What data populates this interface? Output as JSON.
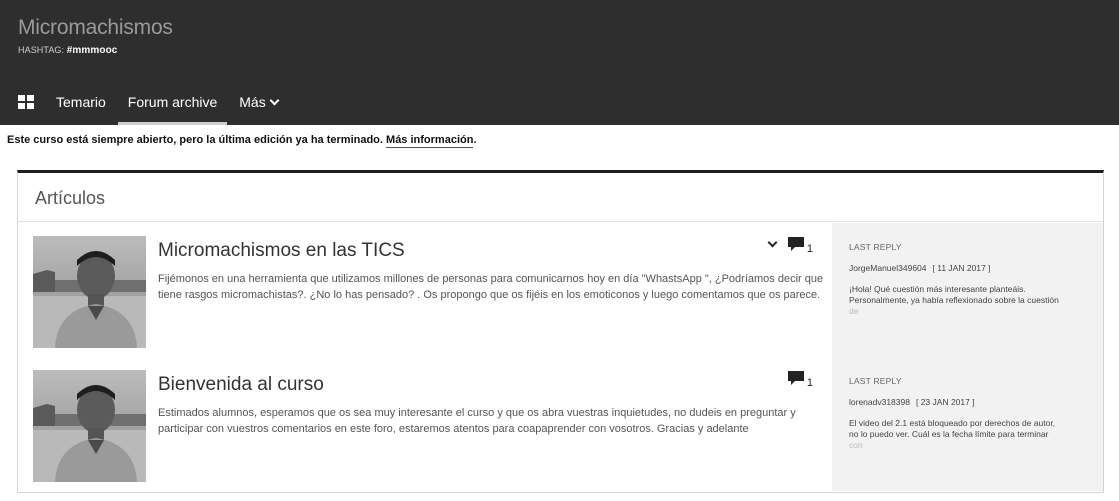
{
  "course": {
    "title": "Micromachismos",
    "hashtag_label": "HASHTAG:",
    "hashtag": "#mmmooc"
  },
  "nav": {
    "items": [
      {
        "label": "Temario",
        "active": false
      },
      {
        "label": "Forum archive",
        "active": true
      },
      {
        "label": "Más",
        "active": false
      }
    ]
  },
  "notice": {
    "text": "Este curso está siempre abierto, pero la última edición ya ha terminado.",
    "link": "Más información",
    "end": "."
  },
  "articles": {
    "heading": "Artículos",
    "posts": [
      {
        "title": "Micromachismos en las TICS",
        "body": "Fijémonos en una herramienta que utilizamos millones de personas para comunicarnos hoy en día \"WhastsApp \", ¿Podríamos decir que tiene rasgos micromachistas?. ¿No lo has pensado? . Os propongo que os fijéis en los emoticonos y luego comentamos que os parece.",
        "comment_count": "1",
        "last_reply_label": "LAST REPLY",
        "last_reply_user": "JorgeManuel349604",
        "last_reply_date": "[ 11 JAN 2017 ]",
        "last_reply_text": "¡Hola! Qué cuestión más interesante planteáis. Personalmente, ya había reflexionado sobre la cuestión",
        "last_reply_fade": " de"
      },
      {
        "title": "Bienvenida al curso",
        "body": "Estimados alumnos, esperamos que os sea muy interesante el curso y que os abra vuestras inquietudes, no dudeis en preguntar y participar con vuestros comentarios en este foro, estaremos atentos para coapaprender con vosotros. Gracias y adelante",
        "comment_count": "1",
        "last_reply_label": "LAST REPLY",
        "last_reply_user": "lorenadv318398",
        "last_reply_date": "[ 23 JAN 2017 ]",
        "last_reply_text": "El video del 2.1 está bloqueado por derechos de autor, no lo puedo ver. Cuál es la fecha límite para terminar",
        "last_reply_fade": " con"
      }
    ]
  },
  "icons": {
    "grid": "grid-icon",
    "chevron": "chevron-down-icon",
    "comment": "comment-icon"
  },
  "colors": {
    "header_bg": "#2e2e2e",
    "sidebar_bg": "#f2f2f2",
    "panel_top_border": "#1e1e1e"
  }
}
